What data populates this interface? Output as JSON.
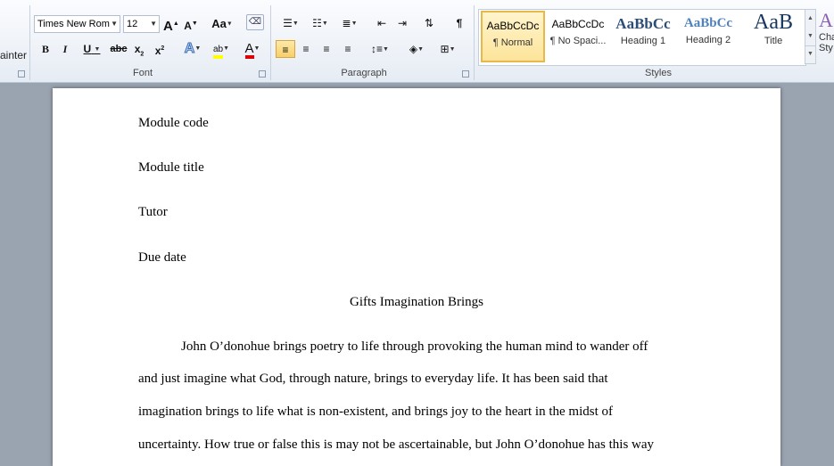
{
  "clipboard": {
    "format_painter_partial": "ainter"
  },
  "font": {
    "name": "Times New Rom",
    "size": "12",
    "group_label": "Font",
    "grow_label": "A",
    "shrink_label": "A",
    "case_label": "Aa",
    "bold_label": "B",
    "italic_label": "I",
    "underline_label": "U",
    "strike_label": "abc",
    "subscript_label": "x",
    "superscript_label": "x",
    "highlight_label": "ab",
    "color_label": "A",
    "highlight_color": "#ffff00",
    "font_color": "#e00000"
  },
  "paragraph": {
    "group_label": "Paragraph"
  },
  "styles": {
    "group_label": "Styles",
    "items": [
      {
        "sample": "AaBbCcDc",
        "name": "¶ Normal"
      },
      {
        "sample": "AaBbCcDc",
        "name": "¶ No Spaci..."
      },
      {
        "sample": "AaBbCc",
        "name": "Heading 1"
      },
      {
        "sample": "AaBbCc",
        "name": "Heading 2"
      },
      {
        "sample": "AaB",
        "name": "Title"
      }
    ],
    "change_styles_partial_1": "Cha",
    "change_styles_partial_2": "Sty"
  },
  "document": {
    "module_code": "Module code",
    "module_title": "Module title",
    "tutor": "Tutor",
    "due_date": "Due date",
    "title": "Gifts Imagination Brings",
    "lines": [
      "John O’donohue brings poetry to life through provoking the human mind to wander off",
      "and just imagine  what God, through nature, brings to everyday life.  It has been said that",
      "imagination brings to life what is non-existent, and brings joy to the heart in the midst of",
      "uncertainty. How true or false this is may not be ascertainable, but John O’donohue has this way"
    ]
  },
  "colors": {
    "accent": "#f8cf6a",
    "heading_blue": "#17365d",
    "heading2_blue": "#4f81bd"
  }
}
